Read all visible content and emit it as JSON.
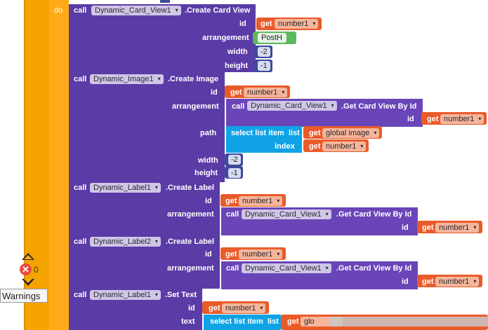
{
  "blocks": {
    "do_label": "do",
    "call_label": "call",
    "get_label": "get",
    "id_label": "id",
    "arrangement_label": "arrangement",
    "width_label": "width",
    "height_label": "height",
    "path_label": "path",
    "index_label": "index",
    "text_label": "text",
    "select_list_item": "select list item",
    "list_label": "list",
    "card_view_component": "Dynamic_Card_View1",
    "create_card_view": ".Create Card View",
    "get_card_view_by_id": ".Get Card View By Id",
    "image_component": "Dynamic_Image1",
    "create_image": ".Create Image",
    "label1_component": "Dynamic_Label1",
    "label2_component": "Dynamic_Label2",
    "create_label": ".Create Label",
    "set_text": ".Set Text",
    "var_number1": "number1",
    "var_global_image": "global image",
    "var_glo_partial": "glo",
    "arrangement_value": "PostH",
    "num_neg2": "-2",
    "num_neg1": "-1"
  },
  "warnings": {
    "error_count": "0",
    "toggle_label": "Warnings"
  },
  "colors": {
    "event_orange": "#ffab19",
    "component_purple": "#5b3ba6",
    "get_red": "#ea5b2a",
    "list_blue": "#0fa3e6",
    "math_navy": "#3c4a9b",
    "text_green": "#5cb85c"
  }
}
